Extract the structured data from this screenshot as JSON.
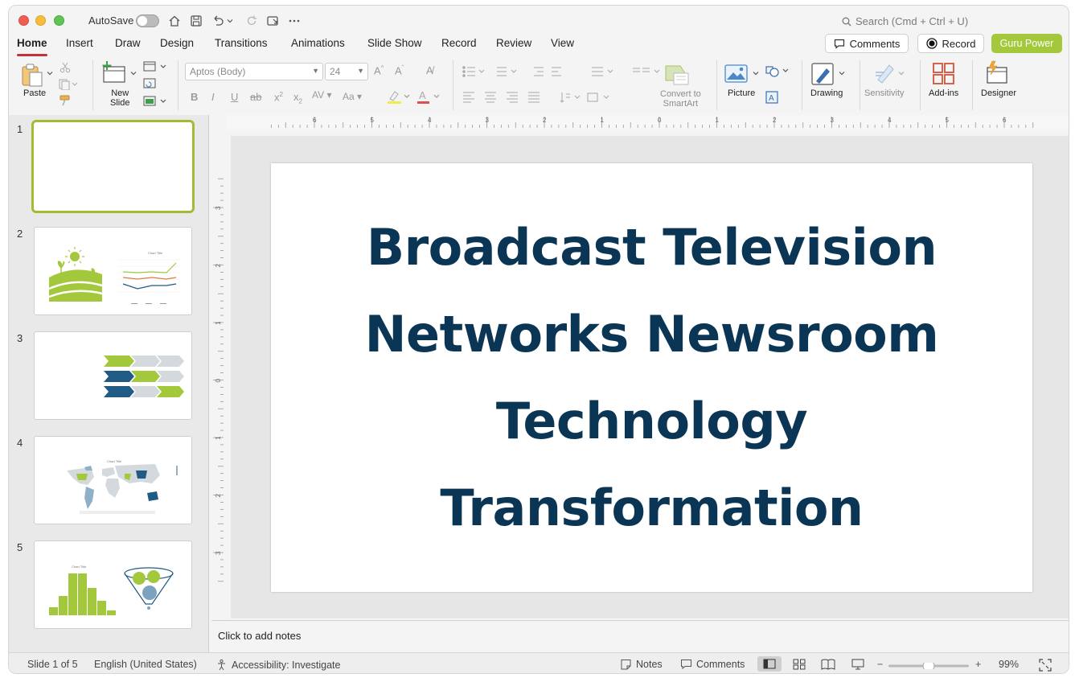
{
  "titlebar": {
    "autosave_label": "AutoSave",
    "search_placeholder": "Search (Cmd + Ctrl + U)"
  },
  "tabs": [
    {
      "label": "Home",
      "active": true
    },
    {
      "label": "Insert"
    },
    {
      "label": "Draw"
    },
    {
      "label": "Design"
    },
    {
      "label": "Transitions"
    },
    {
      "label": "Animations"
    },
    {
      "label": "Slide Show"
    },
    {
      "label": "Record"
    },
    {
      "label": "Review"
    },
    {
      "label": "View"
    }
  ],
  "actions": {
    "comments_label": "Comments",
    "record_label": "Record",
    "guru_label": "Guru Power"
  },
  "ribbon": {
    "paste_label": "Paste",
    "new_slide_label_1": "New",
    "new_slide_label_2": "Slide",
    "font_name": "Aptos (Body)",
    "font_size": "24",
    "smartart_label_1": "Convert to",
    "smartart_label_2": "SmartArt",
    "picture_label": "Picture",
    "drawing_label": "Drawing",
    "sensitivity_label": "Sensitivity",
    "addins_label": "Add-ins",
    "designer_label": "Designer"
  },
  "thumbnails": {
    "numbers": [
      "1",
      "2",
      "3",
      "4",
      "5"
    ],
    "selected": 1,
    "chart_title": "Chart Title"
  },
  "ruler": {
    "top_labels": [
      "6",
      "5",
      "4",
      "3",
      "2",
      "1",
      "0",
      "1",
      "2",
      "3",
      "4",
      "5",
      "6"
    ],
    "left_labels": [
      "3",
      "2",
      "1",
      "0",
      "1",
      "2",
      "3"
    ]
  },
  "slide": {
    "title": "Broadcast Television Networks Newsroom Technology Transformation"
  },
  "notes": {
    "placeholder": "Click to add notes"
  },
  "status": {
    "slide_count": "Slide 1 of 5",
    "language": "English (United States)",
    "accessibility": "Accessibility: Investigate",
    "notes_label": "Notes",
    "comments_label": "Comments",
    "zoom_level": "99%"
  },
  "colors": {
    "accent_green": "#a3c83b",
    "title_navy": "#0a3554",
    "chart_blue": "#1f5b84",
    "chart_grey": "#d4d9de"
  }
}
